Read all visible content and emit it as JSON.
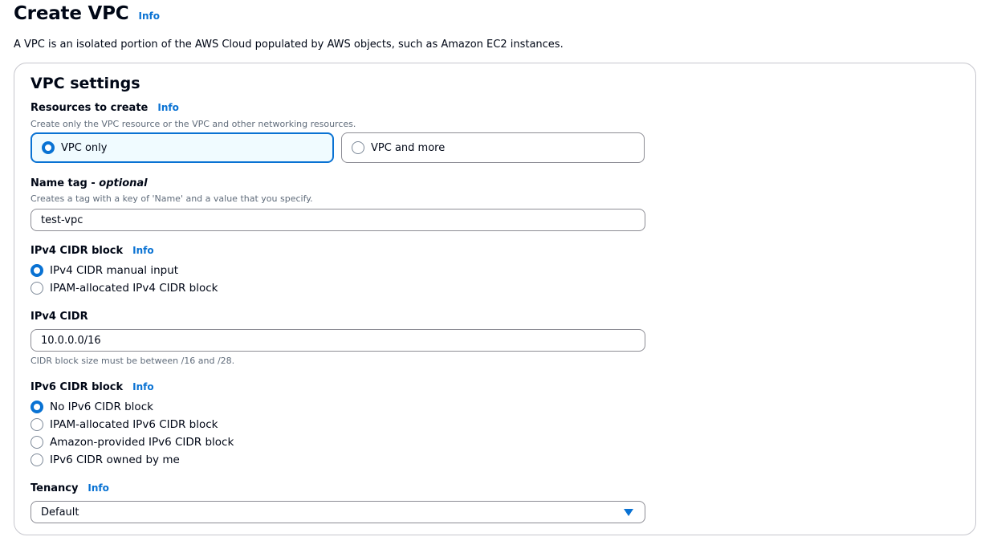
{
  "header": {
    "title": "Create VPC",
    "info": "Info",
    "description": "A VPC is an isolated portion of the AWS Cloud populated by AWS objects, such as Amazon EC2 instances."
  },
  "settings": {
    "title": "VPC settings",
    "resources": {
      "label": "Resources to create",
      "info": "Info",
      "description": "Create only the VPC resource or the VPC and other networking resources.",
      "options": [
        "VPC only",
        "VPC and more"
      ],
      "selected": "VPC only"
    },
    "name_tag": {
      "label": "Name tag - ",
      "optional": "optional",
      "description": "Creates a tag with a key of 'Name' and a value that you specify.",
      "value": "test-vpc"
    },
    "ipv4_block": {
      "label": "IPv4 CIDR block",
      "info": "Info",
      "options": [
        "IPv4 CIDR manual input",
        "IPAM-allocated IPv4 CIDR block"
      ],
      "selected": "IPv4 CIDR manual input"
    },
    "ipv4_cidr": {
      "label": "IPv4 CIDR",
      "value": "10.0.0.0/16",
      "hint": "CIDR block size must be between /16 and /28."
    },
    "ipv6_block": {
      "label": "IPv6 CIDR block",
      "info": "Info",
      "options": [
        "No IPv6 CIDR block",
        "IPAM-allocated IPv6 CIDR block",
        "Amazon-provided IPv6 CIDR block",
        "IPv6 CIDR owned by me"
      ],
      "selected": "No IPv6 CIDR block"
    },
    "tenancy": {
      "label": "Tenancy",
      "info": "Info",
      "value": "Default"
    }
  },
  "colors": {
    "accent": "#0972d3",
    "text": "#000716",
    "secondary_text": "#5f6b7a",
    "border": "#8c8c94"
  },
  "icons": {
    "tenancy_select": "caret-down-icon"
  }
}
